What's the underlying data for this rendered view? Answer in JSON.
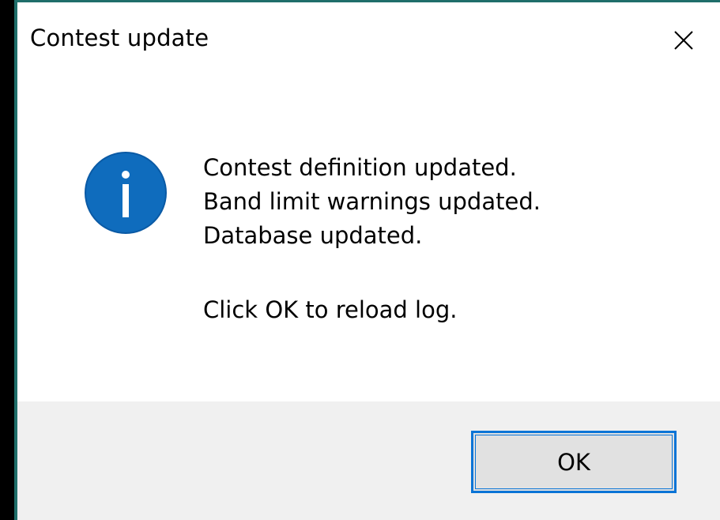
{
  "dialog": {
    "title": "Contest update",
    "icon": "information-icon",
    "message_lines": [
      "Contest definition updated.",
      "Band limit warnings updated.",
      "Database updated.",
      "",
      "Click OK to reload log."
    ],
    "ok_label": "OK"
  },
  "colors": {
    "accent": "#0a74d6",
    "icon_blue": "#0f6cbd",
    "footer_bg": "#f0f0f0",
    "window_border": "#1f6e6a"
  }
}
